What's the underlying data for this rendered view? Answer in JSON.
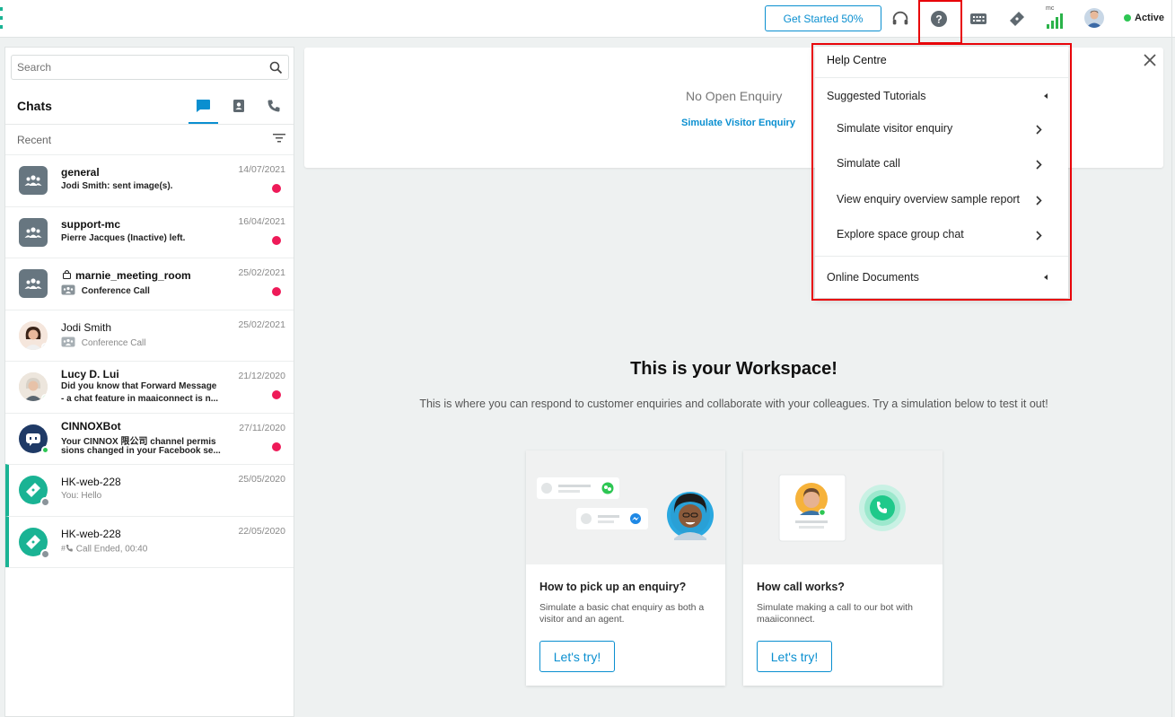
{
  "topbar": {
    "get_started_label": "Get Started 50%",
    "signal_label": "mc",
    "status_label": "Active",
    "status_color": "#2dc653",
    "icons": [
      "headset-icon",
      "help-icon",
      "keypad-icon",
      "ticket-icon",
      "signal-icon"
    ]
  },
  "sidebar": {
    "search_placeholder": "Search",
    "chats_title": "Chats",
    "tabs": [
      "chats-tab",
      "contacts-tab",
      "calls-tab"
    ],
    "recent_label": "Recent",
    "items": [
      {
        "name": "general",
        "sub": "Jodi Smith:  sent image(s).",
        "date": "14/07/2021",
        "type": "group",
        "unread": true
      },
      {
        "name": "support-mc",
        "sub": "Pierre Jacques (Inactive) left.",
        "date": "16/04/2021",
        "type": "group",
        "unread": true
      },
      {
        "name": "marnie_meeting_room",
        "sub": "Conference Call",
        "date": "25/02/2021",
        "type": "group",
        "unread": true
      },
      {
        "name": "Jodi Smith",
        "sub": "Conference Call",
        "date": "25/02/2021",
        "type": "person",
        "unread": false
      },
      {
        "name": "Lucy D. Lui",
        "sub": "Did you know that Forward Message",
        "sub2": "- a chat feature in maaiconnect is n...",
        "date": "21/12/2020",
        "type": "person",
        "unread": true
      },
      {
        "name": "CINNOXBot",
        "sub": "Your CINNOX 限公司 channel permis",
        "sub2": "sions changed in your Facebook se...",
        "date": "27/11/2020",
        "type": "bot",
        "unread": true
      },
      {
        "name": "HK-web-228",
        "sub": "You: Hello",
        "date": "25/05/2020",
        "type": "web",
        "unread": false
      },
      {
        "name": "HK-web-228",
        "sub": "Call Ended, 00:40",
        "date": "22/05/2020",
        "type": "web",
        "unread": false
      }
    ]
  },
  "enquiry": {
    "no_open": "No Open Enquiry",
    "simulate_link": "Simulate Visitor Enquiry"
  },
  "help_menu": {
    "title": "Help Centre",
    "suggested_label": "Suggested Tutorials",
    "items": [
      "Simulate visitor enquiry",
      "Simulate call",
      "View enquiry overview sample report",
      "Explore space group chat"
    ],
    "online_docs_label": "Online Documents"
  },
  "workspace": {
    "title": "This is your Workspace!",
    "subtitle": "This is where you can respond to customer enquiries and collaborate with your colleagues. Try a simulation below to test it out!",
    "cards": [
      {
        "title": "How to pick up an enquiry?",
        "desc": "Simulate a basic chat enquiry as both a visitor and an agent.",
        "button": "Let's try!"
      },
      {
        "title": "How call works?",
        "desc": "Simulate making a call to our bot with maaiiconnect.",
        "button": "Let's try!"
      }
    ]
  },
  "colors": {
    "accent": "#0a8fd0",
    "brand_green": "#1ab394",
    "unread": "#ee1a58",
    "highlight": "#e8050a"
  }
}
